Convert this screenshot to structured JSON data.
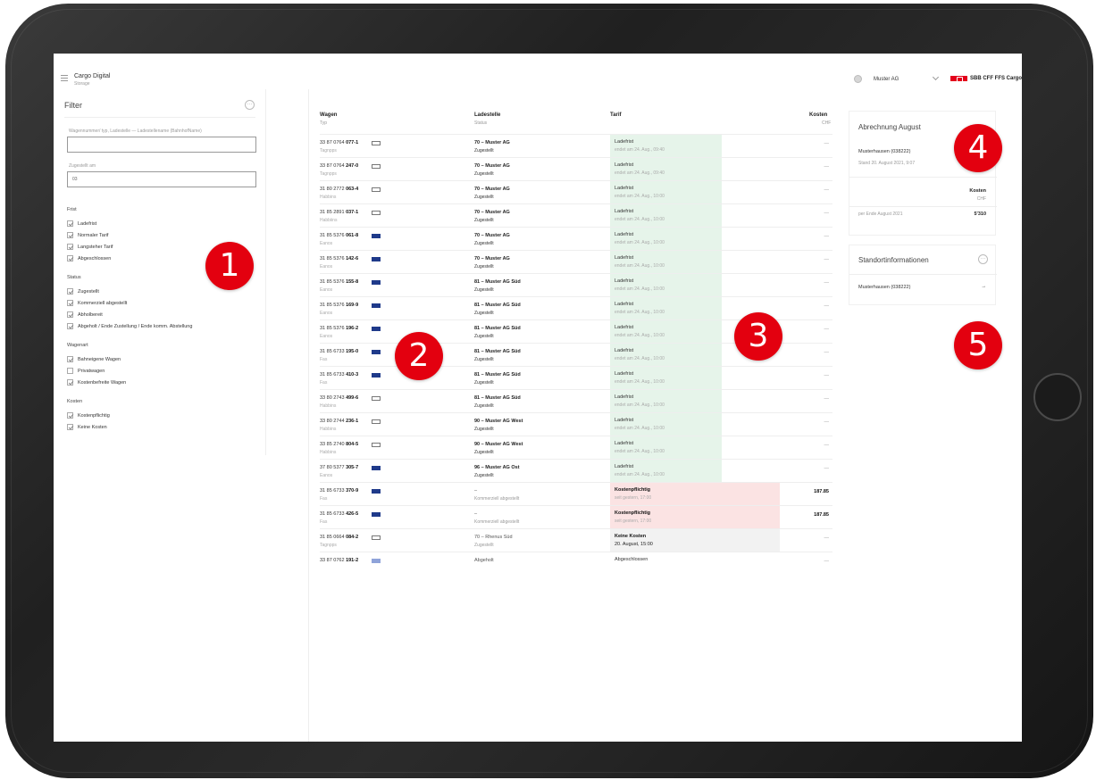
{
  "header": {
    "app_title": "Cargo Digital",
    "app_subtitle": "Storage",
    "company": "Muster AG",
    "brand": "SBB CFF FFS Cargo"
  },
  "filter": {
    "title": "Filter",
    "more": "···",
    "search_label": "Wagennummer/ typ, Ladestelle — Ladestellename (BahnhofName)",
    "search_value": "",
    "date_label": "Zugestellt am",
    "date_value": "03",
    "groups": [
      {
        "label": "Frist",
        "items": [
          {
            "label": "Ladefrist",
            "checked": true
          },
          {
            "label": "Normaler Tarif",
            "checked": true
          },
          {
            "label": "Langsteher Tarif",
            "checked": true
          },
          {
            "label": "Abgeschlossen",
            "checked": true
          }
        ]
      },
      {
        "label": "Status",
        "items": [
          {
            "label": "Zugestellt",
            "checked": true
          },
          {
            "label": "Kommerziell abgestellt",
            "checked": true
          },
          {
            "label": "Abholbereit",
            "checked": true
          },
          {
            "label": "Abgeholt / Ende Zustellung / Ende komm. Abstellung",
            "checked": true
          }
        ]
      },
      {
        "label": "Wagenart",
        "items": [
          {
            "label": "Bahneigene Wagen",
            "checked": true
          },
          {
            "label": "Privatwagen",
            "checked": false
          },
          {
            "label": "Kostenbefreite Wagen",
            "checked": true
          }
        ]
      },
      {
        "label": "Kosten",
        "items": [
          {
            "label": "Kostenpflichtig",
            "checked": true
          },
          {
            "label": "Keine Kosten",
            "checked": true
          }
        ]
      }
    ]
  },
  "table": {
    "headers": {
      "wagen": "Wagen",
      "wagen_sub": "Typ",
      "ladestelle": "Ladestelle",
      "ladestelle_sub": "Status",
      "tarif": "Tarif",
      "kosten": "Kosten",
      "kosten_sub": "CHF"
    },
    "rows": [
      {
        "num": "33 87 0764",
        "suffix": "077-1",
        "type": "Tagnpps",
        "icon": "wagon-empty-icon",
        "station": "70 – Muster AG",
        "status": "Zugestellt",
        "tarif": "Ladefrist",
        "tarif_sub": "endet am 24. Aug., 09:40",
        "cost": "—",
        "style": "green"
      },
      {
        "num": "33 87 0764",
        "suffix": "247-0",
        "type": "Tagnpps",
        "icon": "wagon-empty-icon",
        "station": "70 – Muster AG",
        "status": "Zugestellt",
        "tarif": "Ladefrist",
        "tarif_sub": "endet am 24. Aug., 09:40",
        "cost": "—",
        "style": "green"
      },
      {
        "num": "31 80 2772",
        "suffix": "063-4",
        "type": "Habbins",
        "icon": "wagon-empty-icon",
        "station": "70 – Muster AG",
        "status": "Zugestellt",
        "tarif": "Ladefrist",
        "tarif_sub": "endet am 24. Aug., 10:00",
        "cost": "—",
        "style": "green"
      },
      {
        "num": "31 85 2891",
        "suffix": "037-1",
        "type": "Habbiins",
        "icon": "wagon-empty-icon",
        "station": "70 – Muster AG",
        "status": "Zugestellt",
        "tarif": "Ladefrist",
        "tarif_sub": "endet am 24. Aug., 10:00",
        "cost": "—",
        "style": "green"
      },
      {
        "num": "31 85 5376",
        "suffix": "061-8",
        "type": "Eanos",
        "icon": "wagon-filled-icon",
        "station": "70 – Muster AG",
        "status": "Zugestellt",
        "tarif": "Ladefrist",
        "tarif_sub": "endet am 24. Aug., 10:00",
        "cost": "—",
        "style": "green"
      },
      {
        "num": "31 85 5376",
        "suffix": "142-6",
        "type": "Eanos",
        "icon": "wagon-filled-icon",
        "station": "70 – Muster AG",
        "status": "Zugestellt",
        "tarif": "Ladefrist",
        "tarif_sub": "endet am 24. Aug., 10:00",
        "cost": "—",
        "style": "green"
      },
      {
        "num": "31 85 5376",
        "suffix": "155-8",
        "type": "Eanos",
        "icon": "wagon-filled-icon",
        "station": "81 – Muster AG Süd",
        "status": "Zugestellt",
        "tarif": "Ladefrist",
        "tarif_sub": "endet am 24. Aug., 10:00",
        "cost": "—",
        "style": "green"
      },
      {
        "num": "31 85 5376",
        "suffix": "169-9",
        "type": "Eanos",
        "icon": "wagon-filled-icon",
        "station": "81 – Muster AG Süd",
        "status": "Zugestellt",
        "tarif": "Ladefrist",
        "tarif_sub": "endet am 24. Aug., 10:00",
        "cost": "—",
        "style": "green"
      },
      {
        "num": "31 85 5376",
        "suffix": "196-2",
        "type": "Eanos",
        "icon": "wagon-filled-icon",
        "station": "81 – Muster AG Süd",
        "status": "Zugestellt",
        "tarif": "Ladefrist",
        "tarif_sub": "endet am 24. Aug., 10:00",
        "cost": "—",
        "style": "green"
      },
      {
        "num": "31 85 6733",
        "suffix": "195-0",
        "type": "Fas",
        "icon": "wagon-filled-icon",
        "station": "81 – Muster AG Süd",
        "status": "Zugestellt",
        "tarif": "Ladefrist",
        "tarif_sub": "endet am 24. Aug., 10:00",
        "cost": "—",
        "style": "green"
      },
      {
        "num": "31 85 6733",
        "suffix": "410-3",
        "type": "Fas",
        "icon": "wagon-filled-icon",
        "station": "81 – Muster AG Süd",
        "status": "Zugestellt",
        "tarif": "Ladefrist",
        "tarif_sub": "endet am 24. Aug., 10:00",
        "cost": "—",
        "style": "green"
      },
      {
        "num": "33 80 2743",
        "suffix": "499-6",
        "type": "Habbins",
        "icon": "wagon-empty-icon",
        "station": "81 – Muster AG Süd",
        "status": "Zugestellt",
        "tarif": "Ladefrist",
        "tarif_sub": "endet am 24. Aug., 10:00",
        "cost": "—",
        "style": "green"
      },
      {
        "num": "33 80 2744",
        "suffix": "236-1",
        "type": "Habbins",
        "icon": "wagon-empty-icon",
        "station": "90 – Muster AG West",
        "status": "Zugestellt",
        "tarif": "Ladefrist",
        "tarif_sub": "endet am 24. Aug., 10:00",
        "cost": "—",
        "style": "green"
      },
      {
        "num": "33 85 2740",
        "suffix": "804-5",
        "type": "Habbins",
        "icon": "wagon-empty-icon",
        "station": "90 – Muster AG West",
        "status": "Zugestellt",
        "tarif": "Ladefrist",
        "tarif_sub": "endet am 24. Aug., 10:00",
        "cost": "—",
        "style": "green"
      },
      {
        "num": "37 80 5377",
        "suffix": "305-7",
        "type": "Eanos",
        "icon": "wagon-filled-icon",
        "station": "96 – Muster AG Ost",
        "status": "Zugestellt",
        "tarif": "Ladefrist",
        "tarif_sub": "endet am 24. Aug., 10:00",
        "cost": "—",
        "style": "green"
      },
      {
        "num": "31 85 6733",
        "suffix": "370-9",
        "type": "Fas",
        "icon": "wagon-filled-icon",
        "station": "–",
        "status": "Kommerziell abgestellt",
        "tarif": "Kostenpflichtig",
        "tarif_sub": "seit gestern, 17:00",
        "cost": "187.85",
        "style": "red"
      },
      {
        "num": "31 85 6733",
        "suffix": "426-5",
        "type": "Fas",
        "icon": "wagon-filled-icon",
        "station": "–",
        "status": "Kommerziell abgestellt",
        "tarif": "Kostenpflichtig",
        "tarif_sub": "seit gestern, 17:00",
        "cost": "187.85",
        "style": "red"
      },
      {
        "num": "31 85 0664",
        "suffix": "084-2",
        "type": "Tagnpps",
        "icon": "wagon-empty-icon",
        "station": "70 – Rhenus Süd",
        "status": "Zugestellt",
        "tarif": "Keine Kosten",
        "tarif_sub": "20. August, 15:00",
        "cost": "—",
        "style": "grey"
      },
      {
        "num": "33 87 0762",
        "suffix": "191-2",
        "type": "",
        "icon": "wagon-light-icon",
        "station": "Abgeholt",
        "status": "",
        "tarif": "Abgeschlossen",
        "tarif_sub": "",
        "cost": "—",
        "style": "none"
      }
    ]
  },
  "billing": {
    "title": "Abrechnung August",
    "location": "Musterhausen (038222)",
    "as_of": "Stand 20. August 2021, 9:07",
    "cost_header": "Kosten",
    "cost_unit": "CHF",
    "period_label": "per Ende August 2021",
    "period_value": "5'310"
  },
  "location_info": {
    "title": "Standortinformationen",
    "more": "···",
    "location": "Musterhausen (038222)",
    "arrow": "→"
  },
  "markers": [
    "1",
    "2",
    "3",
    "4",
    "5"
  ],
  "colors": {
    "accent_red": "#e3000f",
    "brand_red": "#e3001b",
    "ladefrist_green": "#e6f4ea",
    "kosten_red": "#fbe3e3",
    "wagon_blue": "#1f3a8a"
  }
}
